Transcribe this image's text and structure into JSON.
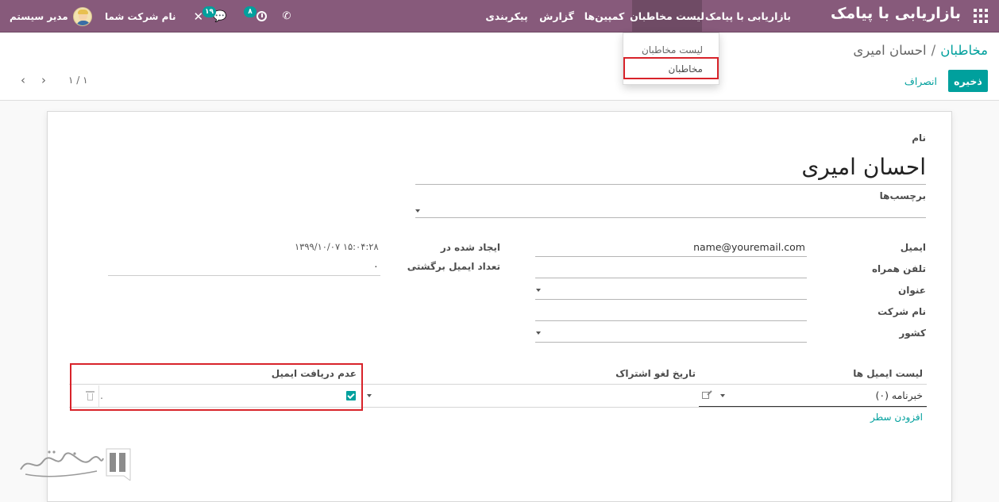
{
  "navbar": {
    "brand": "بازاریابی با پیامک",
    "menu": [
      "بازاریابی با پیامک",
      "لیست مخاطبان",
      "کمپین‌ها",
      "گزارش",
      "پیکربندی"
    ],
    "activity_count": "۸",
    "chat_count": "۱۹",
    "company": "نام شرکت شما",
    "user": "مدیر سیستم"
  },
  "dropdown": {
    "items": [
      "لیست مخاطبان",
      "مخاطبان"
    ]
  },
  "control": {
    "breadcrumb_link": "مخاطبان",
    "breadcrumb_sep": "/",
    "breadcrumb_current": "احسان امیری",
    "save": "ذخیره",
    "discard": "انصراف",
    "pager": "۱ / ۱"
  },
  "form": {
    "name_label": "نام",
    "name_value": "احسان امیری",
    "tags_label": "برچسب‌ها",
    "email_label": "ایمیل",
    "email_value": "name@youremail.com",
    "mobile_label": "تلفن همراه",
    "title_label": "عنوان",
    "company_label": "نام شرکت",
    "country_label": "کشور",
    "created_label": "ایجاد شده در",
    "created_value": "۱۳۹۹/۱۰/۰۷ ۱۵:۰۴:۲۸",
    "bounce_label": "تعداد ایمیل برگشتی",
    "bounce_value": "۰"
  },
  "table": {
    "headers": [
      "لیست ایمیل ها",
      "تاریخ لغو اشتراک",
      "عدم دریافت ایمیل"
    ],
    "row": {
      "mailing_list": "خبرنامه (۰)",
      "unsub_date_dot": "."
    },
    "add_line": "افزودن سطر"
  },
  "colors": {
    "navbar": "#875a7b",
    "accent": "#00a09d",
    "highlight": "#d8232a"
  }
}
